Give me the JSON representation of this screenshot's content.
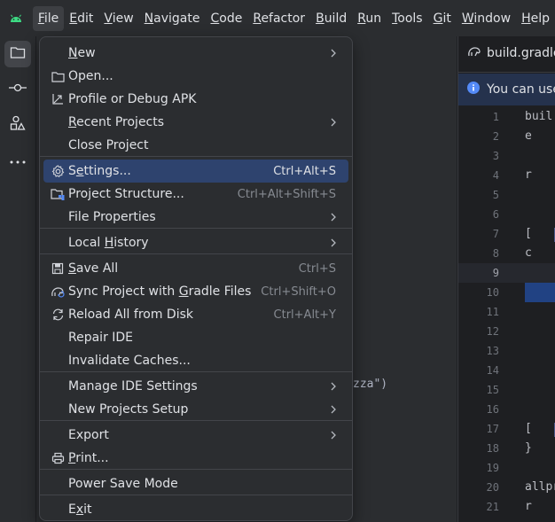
{
  "menubar": {
    "items": [
      {
        "label": "File",
        "u": "F",
        "rest": "ile"
      },
      {
        "label": "Edit",
        "u": "E",
        "rest": "dit"
      },
      {
        "label": "View",
        "u": "V",
        "rest": "iew"
      },
      {
        "label": "Navigate",
        "u": "N",
        "rest": "avigate"
      },
      {
        "label": "Code",
        "u": "C",
        "rest": "ode"
      },
      {
        "label": "Refactor",
        "u": "R",
        "rest": "efactor"
      },
      {
        "label": "Build",
        "u": "B",
        "rest": "uild"
      },
      {
        "label": "Run",
        "u": "R",
        "rest": "un"
      },
      {
        "label": "Tools",
        "u": "T",
        "rest": "ools"
      },
      {
        "label": "Git",
        "u": "G",
        "rest": "it"
      },
      {
        "label": "Window",
        "u": "W",
        "rest": "indow"
      },
      {
        "label": "Help",
        "u": "H",
        "rest": "elp"
      }
    ]
  },
  "editor": {
    "tab_label": "build.gradle",
    "banner_text": "You can use",
    "line_numbers": [
      "1",
      "2",
      "3",
      "4",
      "5",
      "6",
      "7",
      "8",
      "9",
      "10",
      "11",
      "12",
      "13",
      "14",
      "15",
      "16",
      "17",
      "18",
      "19",
      "20",
      "21"
    ],
    "code_lines": [
      "buil",
      "  e",
      "",
      "  r",
      "",
      "",
      "  [",
      "  c",
      "",
      "",
      "",
      "",
      "",
      "",
      "",
      "",
      "  [",
      "}",
      "",
      "allpr",
      "  r"
    ]
  },
  "background_fragment": "zza\")",
  "file_menu": {
    "items": [
      {
        "label": "New",
        "shortcut": "",
        "submenu": true,
        "icon": ""
      },
      {
        "label": "Open...",
        "shortcut": "",
        "submenu": false,
        "icon": "folder-icon"
      },
      {
        "label": "Profile or Debug APK",
        "shortcut": "",
        "submenu": false,
        "icon": "profile-apk-icon"
      },
      {
        "label": "Recent Projects",
        "shortcut": "",
        "submenu": true,
        "icon": ""
      },
      {
        "label": "Close Project",
        "shortcut": "",
        "submenu": false,
        "icon": ""
      },
      {
        "label": "Settings...",
        "shortcut": "Ctrl+Alt+S",
        "submenu": false,
        "icon": "gear-icon"
      },
      {
        "label": "Project Structure...",
        "shortcut": "Ctrl+Alt+Shift+S",
        "submenu": false,
        "icon": "project-structure-icon"
      },
      {
        "label": "File Properties",
        "shortcut": "",
        "submenu": true,
        "icon": ""
      },
      {
        "label": "Local History",
        "shortcut": "",
        "submenu": true,
        "icon": ""
      },
      {
        "label": "Save All",
        "shortcut": "Ctrl+S",
        "submenu": false,
        "icon": "save-icon"
      },
      {
        "label": "Sync Project with Gradle Files",
        "shortcut": "Ctrl+Shift+O",
        "submenu": false,
        "icon": "gradle-sync-icon"
      },
      {
        "label": "Reload All from Disk",
        "shortcut": "Ctrl+Alt+Y",
        "submenu": false,
        "icon": "reload-icon"
      },
      {
        "label": "Repair IDE",
        "shortcut": "",
        "submenu": false,
        "icon": ""
      },
      {
        "label": "Invalidate Caches...",
        "shortcut": "",
        "submenu": false,
        "icon": ""
      },
      {
        "label": "Manage IDE Settings",
        "shortcut": "",
        "submenu": true,
        "icon": ""
      },
      {
        "label": "New Projects Setup",
        "shortcut": "",
        "submenu": true,
        "icon": ""
      },
      {
        "label": "Export",
        "shortcut": "",
        "submenu": true,
        "icon": ""
      },
      {
        "label": "Print...",
        "shortcut": "",
        "submenu": false,
        "icon": "print-icon"
      },
      {
        "label": "Power Save Mode",
        "shortcut": "",
        "submenu": false,
        "icon": ""
      },
      {
        "label": "Exit",
        "shortcut": "",
        "submenu": false,
        "icon": ""
      }
    ],
    "highlighted": "Settings..."
  }
}
